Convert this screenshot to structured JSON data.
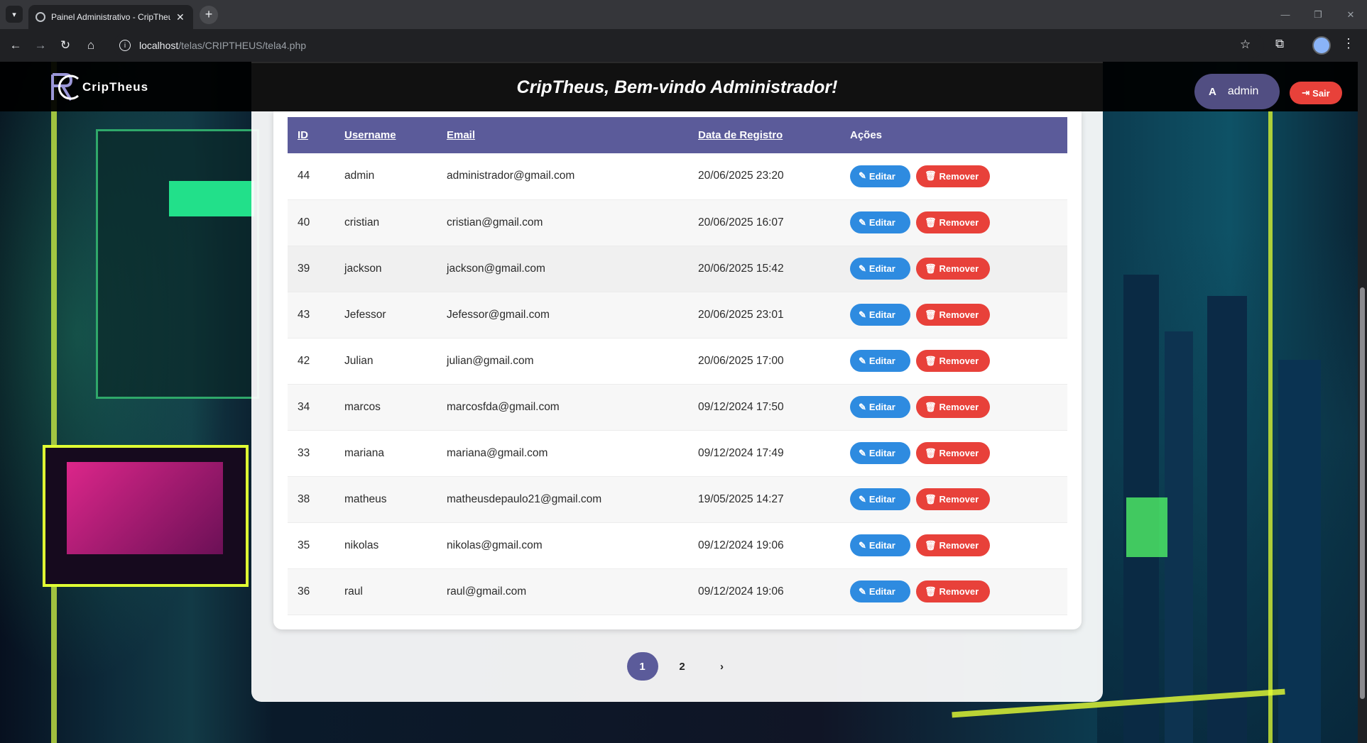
{
  "browser": {
    "tab_title": "Painel Administrativo - CripTheus",
    "url_host": "localhost",
    "url_path": "/telas/CRIPTHEUS/tela4.php",
    "new_tab": "+",
    "controls": [
      "—",
      "❐",
      "✕"
    ]
  },
  "header": {
    "logo_text": "CripTheus",
    "title": "CripTheus, Bem-vindo Administrador!",
    "user_initial": "A",
    "user_name": "admin",
    "logout_label": "Sair"
  },
  "table": {
    "columns": {
      "id": "ID",
      "username": "Username",
      "email": "Email",
      "date": "Data de Registro",
      "actions": "Ações"
    },
    "edit_label": "Editar",
    "remove_label": "Remover",
    "rows": [
      {
        "id": "44",
        "username": "admin",
        "email": "administrador@gmail.com",
        "date": "20/06/2025 23:20"
      },
      {
        "id": "40",
        "username": "cristian",
        "email": "cristian@gmail.com",
        "date": "20/06/2025 16:07"
      },
      {
        "id": "39",
        "username": "jackson",
        "email": "jackson@gmail.com",
        "date": "20/06/2025 15:42"
      },
      {
        "id": "43",
        "username": "Jefessor",
        "email": "Jefessor@gmail.com",
        "date": "20/06/2025 23:01"
      },
      {
        "id": "42",
        "username": "Julian",
        "email": "julian@gmail.com",
        "date": "20/06/2025 17:00"
      },
      {
        "id": "34",
        "username": "marcos",
        "email": "marcosfda@gmail.com",
        "date": "09/12/2024 17:50"
      },
      {
        "id": "33",
        "username": "mariana",
        "email": "mariana@gmail.com",
        "date": "09/12/2024 17:49"
      },
      {
        "id": "38",
        "username": "matheus",
        "email": "matheusdepaulo21@gmail.com",
        "date": "19/05/2025 14:27"
      },
      {
        "id": "35",
        "username": "nikolas",
        "email": "nikolas@gmail.com",
        "date": "09/12/2024 19:06"
      },
      {
        "id": "36",
        "username": "raul",
        "email": "raul@gmail.com",
        "date": "09/12/2024 19:06"
      }
    ]
  },
  "pagination": {
    "pages": [
      "1",
      "2"
    ],
    "current": "1",
    "next": "›"
  },
  "colors": {
    "accent": "#5b5b9a",
    "edit": "#2e8be0",
    "remove": "#e8413a"
  }
}
